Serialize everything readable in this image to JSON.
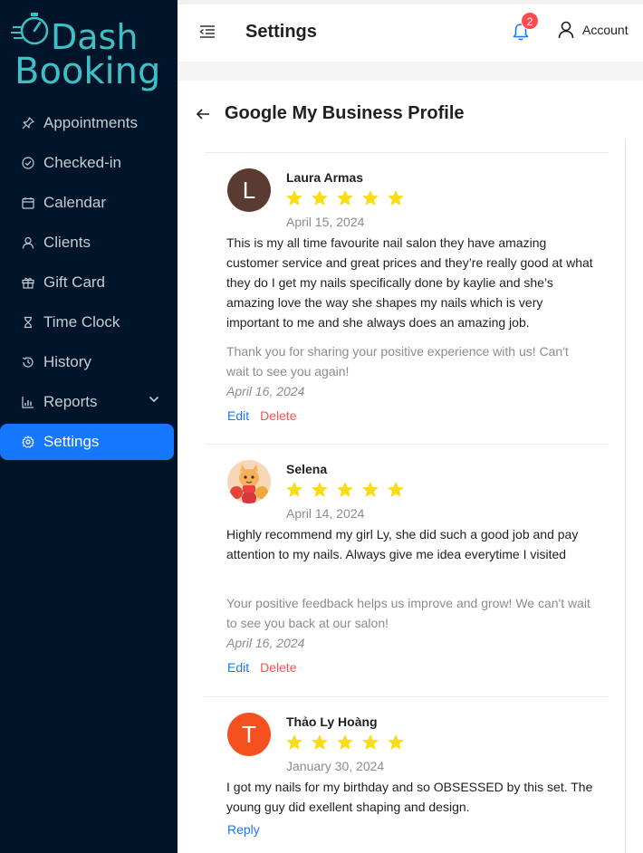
{
  "brand": {
    "line1": "Dash",
    "line2": "Booking",
    "color": "#3fbfc6"
  },
  "sidebar": {
    "items": [
      {
        "label": "Appointments",
        "icon": "pin-icon"
      },
      {
        "label": "Checked-in",
        "icon": "check-circle-icon"
      },
      {
        "label": "Calendar",
        "icon": "calendar-icon"
      },
      {
        "label": "Clients",
        "icon": "user-icon"
      },
      {
        "label": "Gift Card",
        "icon": "gift-icon"
      },
      {
        "label": "Time Clock",
        "icon": "hourglass-icon"
      },
      {
        "label": "History",
        "icon": "history-icon"
      },
      {
        "label": "Reports",
        "icon": "bar-chart-icon"
      },
      {
        "label": "Settings",
        "icon": "gear-icon",
        "active": true
      }
    ]
  },
  "header": {
    "title": "Settings",
    "notification_count": "2",
    "account_label": "Account"
  },
  "page": {
    "title": "Google My Business Profile"
  },
  "reviews": [
    {
      "name": "Laura Armas",
      "avatar_letter": "L",
      "avatar_color": "#5b3a32",
      "rating": 5,
      "date": "April 15, 2024",
      "text": "This is my all time favourite nail salon they have amazing customer service and great prices and they’re really good at what they do I get my nails specifically done by kaylie and she’s amazing love the way she shapes my nails which is very important to me and she always does an amazing job.",
      "reply": "Thank you for sharing your positive experience with us! Can't wait to see you again!",
      "reply_date": "April 16, 2024",
      "edit_label": "Edit",
      "delete_label": "Delete"
    },
    {
      "name": "Selena",
      "avatar_letter": "",
      "avatar_color": "#f7a14a",
      "rating": 5,
      "date": "April 14, 2024",
      "text": "Highly recommend my girl Ly, she did such a good job and pay attention to my nails. Always give me idea everytime I visited",
      "reply": "Your positive feedback helps us improve and grow! We can't wait to see you back at our salon!",
      "reply_date": "April 16, 2024",
      "edit_label": "Edit",
      "delete_label": "Delete"
    },
    {
      "name": "Thảo Ly Hoàng",
      "avatar_letter": "T",
      "avatar_color": "#f4511e",
      "rating": 5,
      "date": "January 30, 2024",
      "text": "I got my nails for my birthday and so OBSESSED by this set. The young guy did exellent shaping and design.",
      "reply_label": "Reply"
    }
  ],
  "colors": {
    "sidebar_bg": "#001529",
    "active": "#1677ff",
    "star": "#fadb14",
    "danger": "#ff4d4f"
  }
}
